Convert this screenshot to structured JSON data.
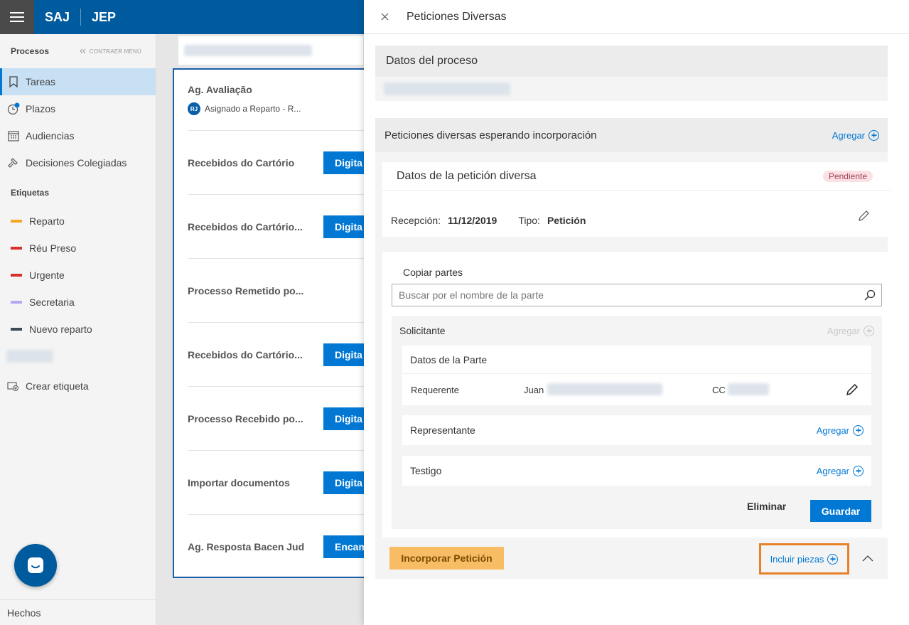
{
  "app": {
    "brand1": "SAJ",
    "brand2": "JEP"
  },
  "sidebar": {
    "title": "Procesos",
    "collapse_label": "CONTRAER MENÚ",
    "items": [
      {
        "label": "Tareas",
        "icon": "bookmark-icon",
        "active": true
      },
      {
        "label": "Plazos",
        "icon": "clock-icon"
      },
      {
        "label": "Audiencias",
        "icon": "calendar-icon"
      },
      {
        "label": "Decisiones Colegiadas",
        "icon": "gavel-icon"
      }
    ],
    "tags_title": "Etiquetas",
    "tags": [
      {
        "label": "Reparto",
        "color": "#f5a623"
      },
      {
        "label": "Réu Preso",
        "color": "#d9302c"
      },
      {
        "label": "Urgente",
        "color": "#d9302c"
      },
      {
        "label": "Secretaria",
        "color": "#b4a7f5"
      },
      {
        "label": "Nuevo reparto",
        "color": "#3d4a5c"
      }
    ],
    "create_tag": "Crear etiqueta",
    "footer": "Hechos"
  },
  "list": {
    "first": {
      "title": "Ag. Avaliação",
      "avatar": "RJ",
      "assigned": "Asignado a Reparto - R..."
    },
    "rows": [
      {
        "title": "Recebidos do Cartório",
        "action": "Digita"
      },
      {
        "title": "Recebidos do Cartório...",
        "action": "Digita"
      },
      {
        "title": "Processo Remetido po...",
        "action": ""
      },
      {
        "title": "Recebidos do Cartório...",
        "action": "Digita"
      },
      {
        "title": "Processo Recebido po...",
        "action": "Digita"
      },
      {
        "title": "Importar documentos",
        "action": "Digita"
      },
      {
        "title": "Ag. Resposta Bacen Jud",
        "action": "Encam"
      }
    ]
  },
  "panel": {
    "title": "Peticiones Diversas",
    "datos_proceso": "Datos del proceso",
    "peticiones_title": "Peticiones diversas esperando incorporación",
    "agregar": "Agregar",
    "peticion": {
      "title": "Datos de la petición diversa",
      "status": "Pendiente",
      "recepcion_label": "Recepción:",
      "recepcion_value": "11/12/2019",
      "tipo_label": "Tipo:",
      "tipo_value": "Petición"
    },
    "copiar_partes": "Copiar partes",
    "search_placeholder": "Buscar por el nombre de la parte",
    "solicitante": {
      "title": "Solicitante",
      "agregar": "Agregar",
      "datos_parte": "Datos de la Parte",
      "role": "Requerente",
      "name": "Juan",
      "doc_type": "CC"
    },
    "representante": {
      "title": "Representante",
      "agregar": "Agregar"
    },
    "testigo": {
      "title": "Testigo",
      "agregar": "Agregar"
    },
    "eliminar": "Eliminar",
    "guardar": "Guardar",
    "incorporar": "Incorporar Petición",
    "incluir_piezas": "Incluir piezas"
  }
}
